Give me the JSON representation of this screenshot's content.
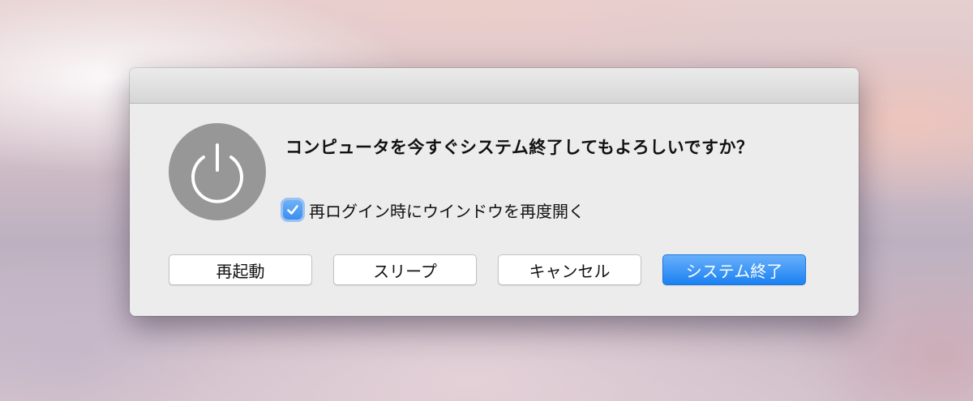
{
  "dialog": {
    "message": "コンピュータを今すぐシステム終了してもよろしいですか？",
    "icon": "power-icon",
    "checkbox": {
      "label": "再ログイン時にウインドウを再度開く",
      "checked": true
    },
    "buttons": {
      "restart": "再起動",
      "sleep": "スリープ",
      "cancel": "キャンセル",
      "shutdown": "システム終了"
    }
  },
  "colors": {
    "accent": "#1b81f2",
    "icon_gray": "#979797",
    "dialog_bg": "#ececec"
  }
}
